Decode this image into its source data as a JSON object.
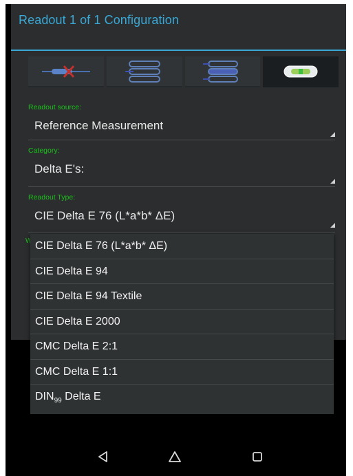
{
  "window": {
    "title": "Readout 1 of 1 Configuration"
  },
  "tabs": [
    {
      "icon": "crossed-probe-icon",
      "active": false
    },
    {
      "icon": "stacked-bars-icon",
      "active": false
    },
    {
      "icon": "stacked-bars-alt-icon",
      "active": false
    },
    {
      "icon": "readout-capsule-icon",
      "active": true
    }
  ],
  "form": {
    "source": {
      "label": "Readout source:",
      "value": "Reference Measurement"
    },
    "category": {
      "label": "Category:",
      "value": "Delta E's:"
    },
    "type": {
      "label": "Readout Type:",
      "value": "CIE Delta E 76 (L*a*b* ΔE)"
    },
    "hidden_label_initial": "W"
  },
  "dropdown": {
    "options": [
      {
        "label": "CIE Delta E 76 (L*a*b* ΔE)"
      },
      {
        "label": "CIE Delta E 94"
      },
      {
        "label": "CIE Delta E 94 Textile"
      },
      {
        "label": "CIE Delta E 2000"
      },
      {
        "label": "CMC Delta E 2:1"
      },
      {
        "label": "CMC Delta E 1:1"
      },
      {
        "label_main": "DIN",
        "label_sub": "99",
        "label_rest": " Delta E"
      }
    ]
  },
  "navbar": {
    "back_icon": "back-triangle-icon",
    "home_icon": "home-icon",
    "recents_icon": "recents-square-icon"
  },
  "colors": {
    "accent": "#39a8d6",
    "label_green": "#19c219",
    "panel": "#2b2d2e",
    "dropdown": "#2f3233"
  }
}
